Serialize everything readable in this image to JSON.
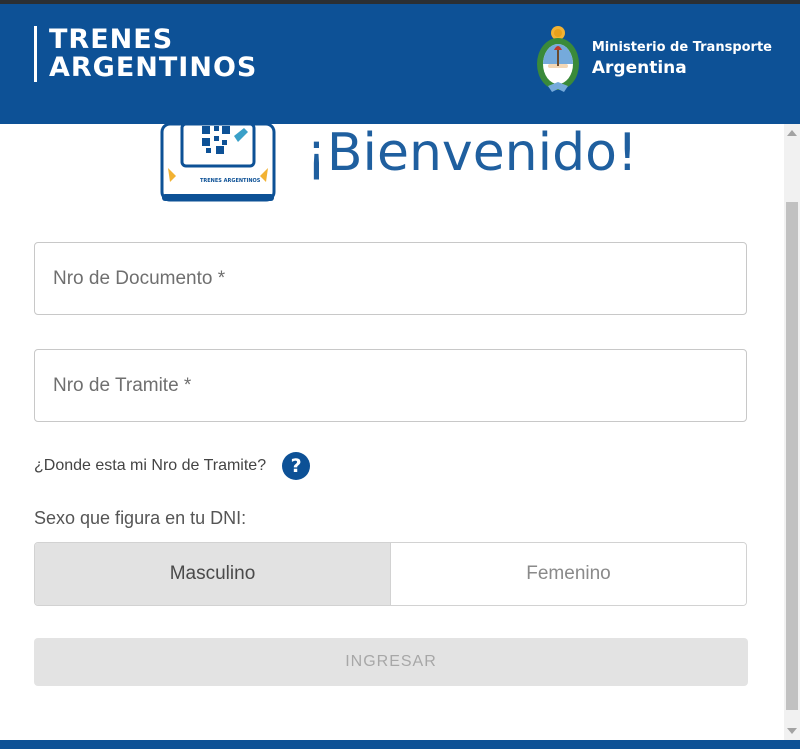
{
  "header": {
    "brand_line1": "TRENES",
    "brand_line2": "ARGENTINOS",
    "ministry_line1": "Ministerio de Transporte",
    "ministry_line2": "Argentina",
    "background_color": "#0d5196"
  },
  "hero": {
    "title": "¡Bienvenido!",
    "image_caption": "TRENES ARGENTINOS",
    "icon": "ticket-machine-icon"
  },
  "form": {
    "document_placeholder": "Nro de Documento *",
    "document_value": "",
    "tramite_placeholder": "Nro de Tramite *",
    "tramite_value": "",
    "help_link": "¿Donde esta mi Nro de Tramite?",
    "help_icon": "?",
    "sex_label": "Sexo que figura en tu DNI:",
    "sex_options": [
      "Masculino",
      "Femenino"
    ],
    "sex_selected": "Masculino",
    "submit_label": "INGRESAR"
  },
  "colors": {
    "primary": "#0d5196",
    "title_blue": "#1f5f9f",
    "button_disabled": "#e3e3e3"
  }
}
